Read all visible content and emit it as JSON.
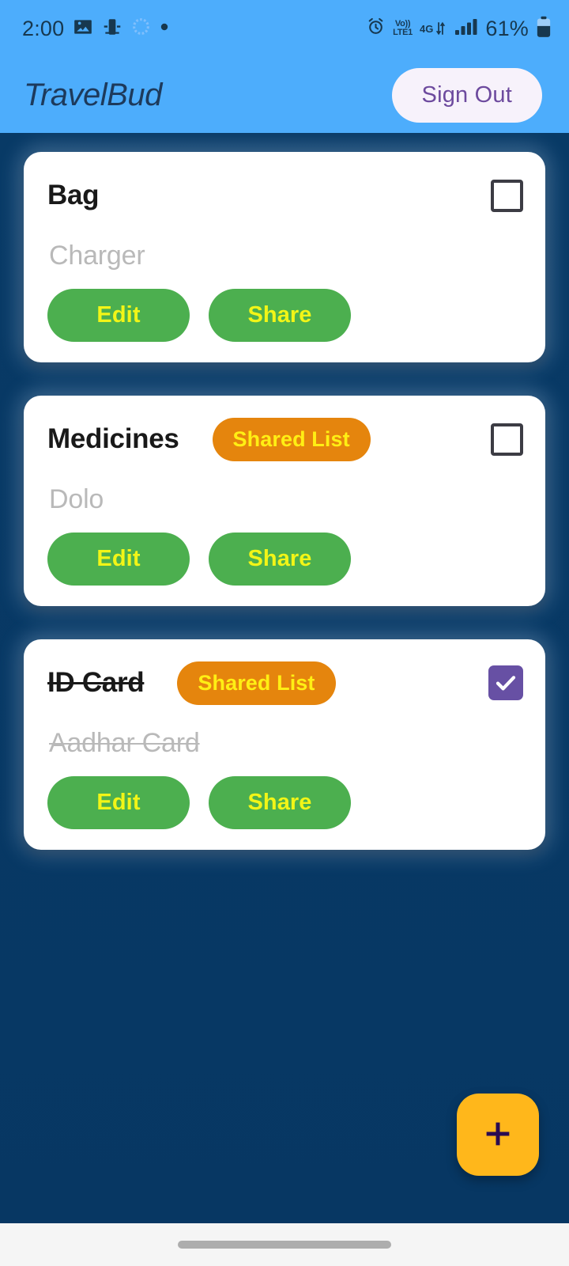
{
  "status_bar": {
    "time": "2:00",
    "left_icons": [
      "photo-icon",
      "screen-cast-icon",
      "loading-spinner-icon",
      "dot-icon"
    ],
    "right_icons": [
      "alarm-icon",
      "volte-icon",
      "4g-data-icon",
      "signal-bars-icon",
      "battery-icon"
    ],
    "volte_line1": "Vo))",
    "volte_line2": "LTE1",
    "network": "4G",
    "battery_percent": "61%"
  },
  "app_bar": {
    "title": "TravelBud",
    "sign_out_label": "Sign Out"
  },
  "colors": {
    "app_bar": "#4dadfc",
    "background": "#083a66",
    "card": "#ffffff",
    "action_button": "#4caf4f",
    "action_button_text": "#f2f517",
    "shared_badge": "#e5850d",
    "shared_badge_text": "#ffef14",
    "checkbox_checked": "#6750a4",
    "fab": "#ffb71b",
    "fab_icon": "#2a0b52",
    "title_text": "#191919",
    "item_text": "#b9b9b9",
    "sign_out_text": "#6d4a9e"
  },
  "lists": [
    {
      "title": "Bag",
      "struck": false,
      "shared": false,
      "shared_label": "",
      "item": "Charger",
      "checked": false,
      "edit_label": "Edit",
      "share_label": "Share"
    },
    {
      "title": "Medicines",
      "struck": false,
      "shared": true,
      "shared_label": "Shared List",
      "item": "Dolo",
      "checked": false,
      "edit_label": "Edit",
      "share_label": "Share"
    },
    {
      "title": "ID Card",
      "struck": true,
      "shared": true,
      "shared_label": "Shared List",
      "item": "Aadhar Card",
      "checked": true,
      "edit_label": "Edit",
      "share_label": "Share"
    }
  ],
  "fab": {
    "icon": "plus-icon",
    "label": "+"
  },
  "nav_bar": {
    "handle": "gesture-handle"
  }
}
